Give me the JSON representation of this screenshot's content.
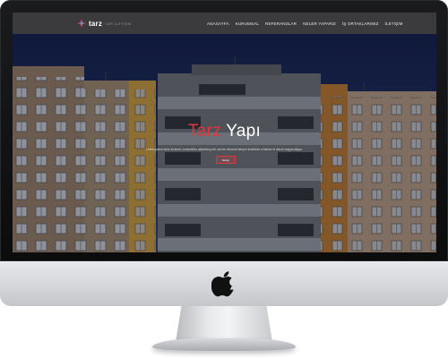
{
  "site": {
    "logo_text": "tarz",
    "logo_sub": "YAPI İLETİŞİM"
  },
  "nav": {
    "items": [
      "ANASAYFA",
      "KURUMSAL",
      "REFERANSLAR",
      "NELER YAPARIZ",
      "İŞ ORTAKLARIMIZ",
      "İLETİŞİM"
    ]
  },
  "hero": {
    "title_accent": "Tarz",
    "title_rest": " Yapı",
    "subtitle": "Lorem ipsum dolor sit amet, consectetur adipisicing elit, sed do eiusmod tempor incididunt ut labore et dolore magna aliqua.",
    "button_label": "Detay"
  },
  "colors": {
    "accent": "#e0363e",
    "navbar": "#3b3b3e",
    "bezel": "#111214",
    "chin": "#d8d9dc"
  }
}
